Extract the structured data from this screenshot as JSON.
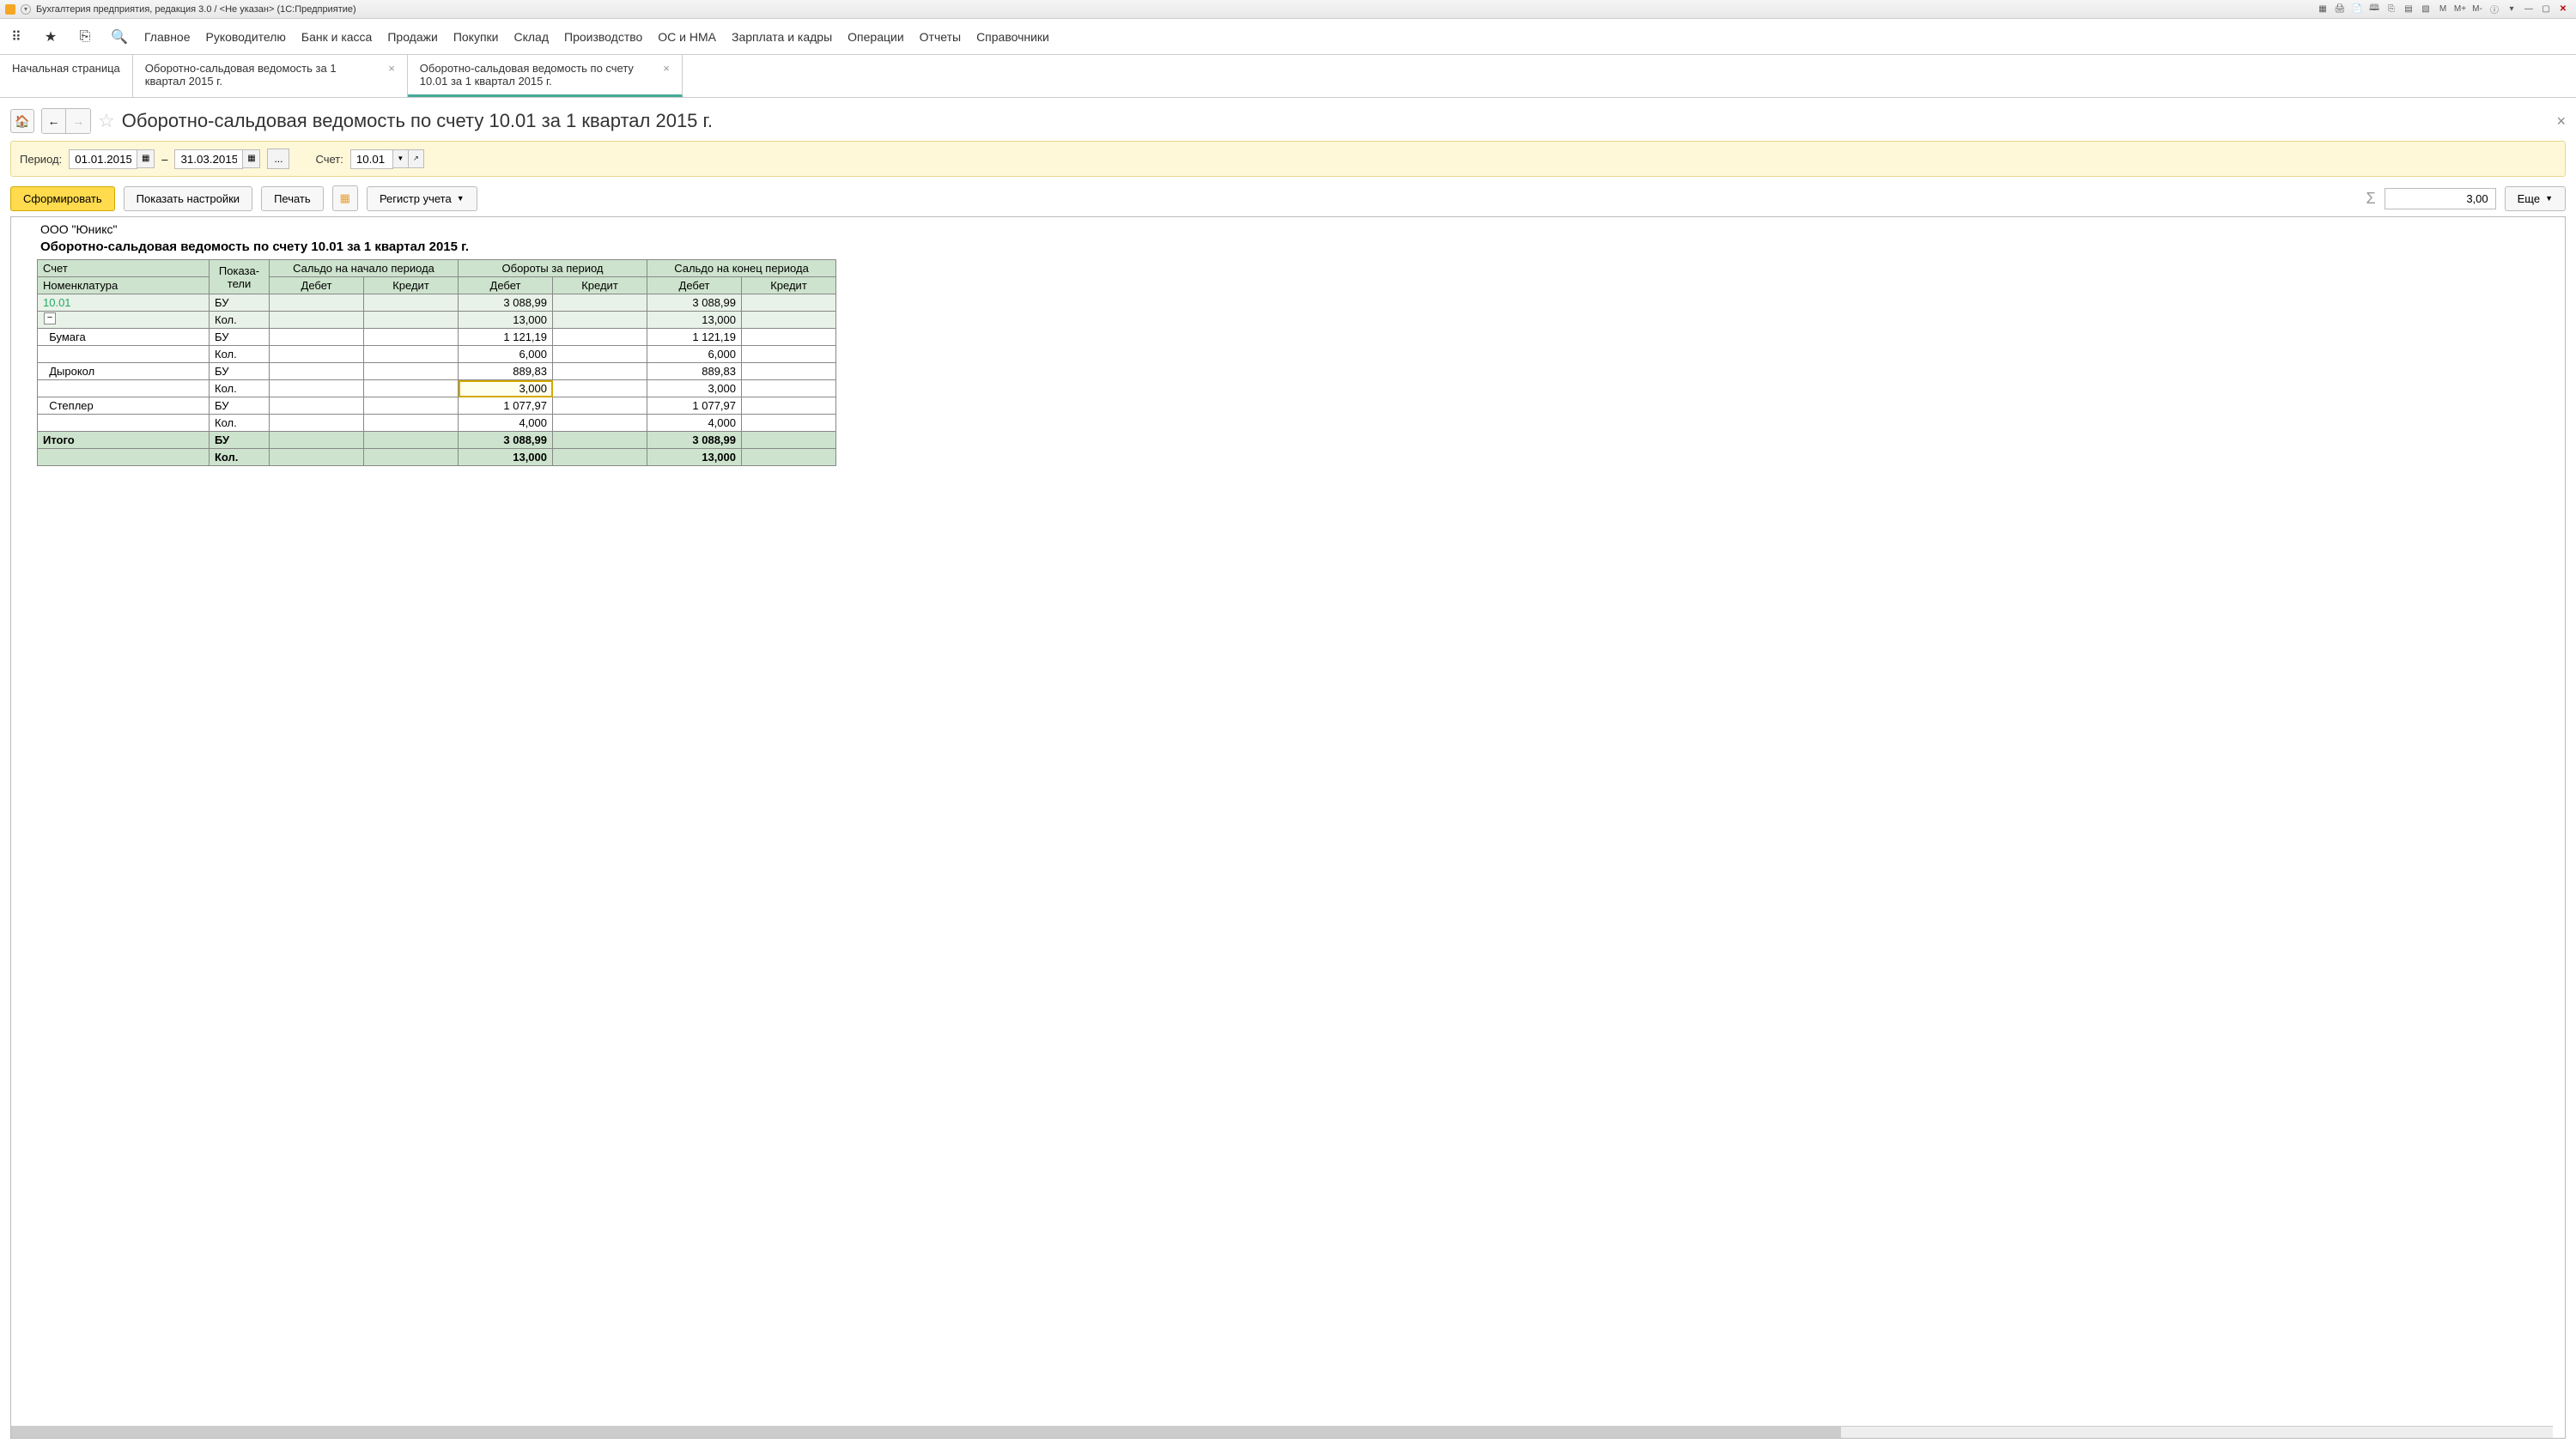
{
  "titlebar": {
    "title": "Бухгалтерия предприятия, редакция 3.0 / <Не указан>  (1С:Предприятие)",
    "m_label": "M",
    "mplus_label": "M+",
    "mminus_label": "M-"
  },
  "maintabs": {
    "items": [
      "Главное",
      "Руководителю",
      "Банк и касса",
      "Продажи",
      "Покупки",
      "Склад",
      "Производство",
      "ОС и НМА",
      "Зарплата и кадры",
      "Операции",
      "Отчеты",
      "Справочники"
    ]
  },
  "doctabs": {
    "items": [
      {
        "label": "Начальная страница",
        "closable": false,
        "active": false
      },
      {
        "label": "Оборотно-сальдовая ведомость за 1 квартал 2015 г.",
        "closable": true,
        "active": false
      },
      {
        "label": "Оборотно-сальдовая ведомость по счету 10.01 за 1 квартал 2015 г.",
        "closable": true,
        "active": true
      }
    ]
  },
  "page": {
    "title": "Оборотно-сальдовая ведомость по счету 10.01 за 1 квартал 2015 г."
  },
  "filter": {
    "period_label": "Период:",
    "date_from": "01.01.2015",
    "date_to": "31.03.2015",
    "dash": "–",
    "ellipsis": "...",
    "account_label": "Счет:",
    "account_value": "10.01"
  },
  "toolbar": {
    "form_btn": "Сформировать",
    "settings_btn": "Показать настройки",
    "print_btn": "Печать",
    "register_btn": "Регистр учета",
    "sum_value": "3,00",
    "more_btn": "Еще"
  },
  "report": {
    "org": "ООО \"Юникс\"",
    "title": "Оборотно-сальдовая ведомость по счету 10.01 за 1 квартал 2015 г.",
    "headers": {
      "acct": "Счет",
      "nomen": "Номенклатура",
      "indicators": "Показа-\nтели",
      "open": "Сальдо на начало периода",
      "turn": "Обороты за период",
      "close": "Сальдо на конец периода",
      "debit": "Дебет",
      "credit": "Кредит"
    },
    "indicator_bu": "БУ",
    "indicator_kol": "Кол.",
    "account": "10.01",
    "account_bu": {
      "turn_dt": "3 088,99",
      "close_dt": "3 088,99"
    },
    "account_kol": {
      "turn_dt": "13,000",
      "close_dt": "13,000"
    },
    "rows": [
      {
        "name": "Бумага",
        "bu": {
          "turn_dt": "1 121,19",
          "close_dt": "1 121,19"
        },
        "kol": {
          "turn_dt": "6,000",
          "close_dt": "6,000"
        }
      },
      {
        "name": "Дырокол",
        "bu": {
          "turn_dt": "889,83",
          "close_dt": "889,83"
        },
        "kol": {
          "turn_dt": "3,000",
          "close_dt": "3,000",
          "selected": true
        }
      },
      {
        "name": "Степлер",
        "bu": {
          "turn_dt": "1 077,97",
          "close_dt": "1 077,97"
        },
        "kol": {
          "turn_dt": "4,000",
          "close_dt": "4,000"
        }
      }
    ],
    "total_label": "Итого",
    "total_bu": {
      "turn_dt": "3 088,99",
      "close_dt": "3 088,99"
    },
    "total_kol": {
      "turn_dt": "13,000",
      "close_dt": "13,000"
    }
  }
}
